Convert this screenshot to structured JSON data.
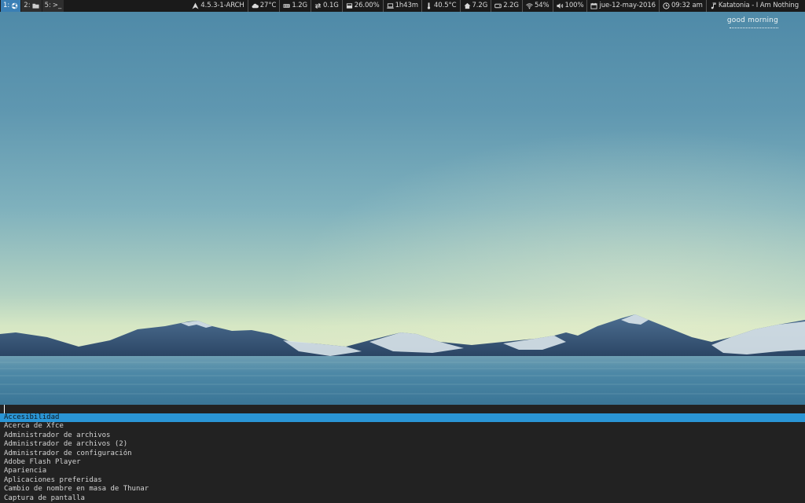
{
  "topbar": {
    "workspaces": [
      {
        "number": "1:",
        "icon": "browser-icon",
        "active": true
      },
      {
        "number": "2:",
        "icon": "folder-icon",
        "active": false
      },
      {
        "number": "5:",
        "icon": "terminal-icon",
        "label": ">_",
        "active": false
      }
    ],
    "status": [
      {
        "icon": "arch-logo-icon",
        "value": "4.5.3-1-ARCH"
      },
      {
        "icon": "cloud-icon",
        "value": "27°C"
      },
      {
        "icon": "memory-icon",
        "value": "1.2G"
      },
      {
        "icon": "swap-icon",
        "value": "0.1G"
      },
      {
        "icon": "cpu-icon",
        "value": "26.00%"
      },
      {
        "icon": "uptime-icon",
        "value": "1h43m"
      },
      {
        "icon": "thermometer-icon",
        "value": "40.5°C"
      },
      {
        "icon": "home-icon",
        "value": "7.2G"
      },
      {
        "icon": "disk-icon",
        "value": "2.2G"
      },
      {
        "icon": "wifi-icon",
        "value": "54%"
      },
      {
        "icon": "volume-icon",
        "value": "100%"
      },
      {
        "icon": "calendar-icon",
        "value": "jue-12-may-2016"
      },
      {
        "icon": "clock-icon",
        "value": "09:32 am"
      },
      {
        "icon": "music-note-icon",
        "value": "Katatonia - I Am Nothing"
      }
    ]
  },
  "desktop": {
    "greeting": "good morning"
  },
  "launcher": {
    "prompt_value": "",
    "items": [
      "Accesibilidad",
      "Acerca de Xfce",
      "Administrador de archivos",
      "Administrador de archivos (2)",
      "Administrador de configuración",
      "Adobe Flash Player",
      "Apariencia",
      "Aplicaciones preferidas",
      "Cambio de nombre en masa de Thunar",
      "Captura de pantalla"
    ],
    "selected_index": 0
  },
  "colors": {
    "bar_bg": "#1a1a1a",
    "active_workspace": "#3a7fb5",
    "launcher_bg": "#222222",
    "selection": "#2a95d5"
  }
}
